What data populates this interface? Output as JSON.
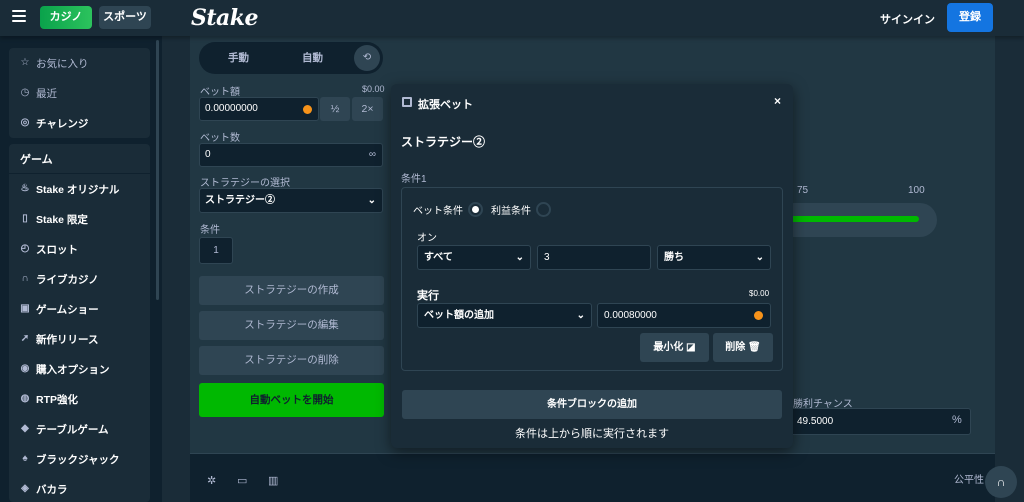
{
  "topbar": {
    "casino": "カジノ",
    "sports": "スポーツ",
    "logo": "Stake",
    "signin": "サインイン",
    "register": "登録"
  },
  "sidebar": {
    "top_items": [
      {
        "label": "お気に入り",
        "icon": "star-icon"
      },
      {
        "label": "最近",
        "icon": "clock-icon"
      },
      {
        "label": "チャレンジ",
        "icon": "target-icon"
      }
    ],
    "games_header": "ゲーム",
    "game_items": [
      {
        "label": "Stake オリジナル",
        "icon": "flame-icon"
      },
      {
        "label": "Stake 限定",
        "icon": "bookmark-icon"
      },
      {
        "label": "スロット",
        "icon": "slot-icon"
      },
      {
        "label": "ライブカジノ",
        "icon": "headset-icon"
      },
      {
        "label": "ゲームショー",
        "icon": "gift-icon"
      },
      {
        "label": "新作リリース",
        "icon": "rocket-icon"
      },
      {
        "label": "購入オプション",
        "icon": "badge-icon"
      },
      {
        "label": "RTP強化",
        "icon": "rtp-icon"
      },
      {
        "label": "テーブルゲーム",
        "icon": "drop-icon"
      },
      {
        "label": "ブラックジャック",
        "icon": "cards-icon"
      },
      {
        "label": "バカラ",
        "icon": "chip-icon"
      }
    ]
  },
  "controls": {
    "mode_manual": "手動",
    "mode_auto": "自動",
    "bet_amount_label": "ベット額",
    "bet_amount_usd": "$0.00",
    "bet_amount_value": "0.00000000",
    "half": "½",
    "double": "2×",
    "bet_count_label": "ベット数",
    "bet_count_value": "0",
    "infinity": "∞",
    "strategy_select_label": "ストラテジーの選択",
    "strategy_selected": "ストラテジー②",
    "conditions_label": "条件",
    "conditions_value": "1",
    "create_strategy": "ストラテジーの作成",
    "edit_strategy": "ストラテジーの編集",
    "delete_strategy": "ストラテジーの削除",
    "start_autobet": "自動ベットを開始"
  },
  "game": {
    "tick_75": "75",
    "tick_100": "100",
    "win_chance_label": "勝利チャンス",
    "win_chance_value": "49.5000",
    "pct": "%",
    "fairness": "公平性"
  },
  "modal": {
    "title": "拡張ベット",
    "close": "×",
    "strategy_name": "ストラテジー②",
    "condition_label": "条件1",
    "radio_bet": "ベット条件",
    "radio_profit": "利益条件",
    "selected_radio": "bet",
    "on_label": "オン",
    "on_select": "すべて",
    "on_count": "3",
    "on_result": "勝ち",
    "exec_label": "実行",
    "exec_usd": "$0.00",
    "exec_action": "ベット額の追加",
    "exec_value": "0.00080000",
    "minimize": "最小化",
    "delete": "削除",
    "add_block": "条件ブロックの追加",
    "note": "条件は上から順に実行されます"
  },
  "colors": {
    "bg": "#1a2c38",
    "panel": "#213743",
    "dark": "#0f212e",
    "accent_green": "#00b801",
    "accent_blue": "#1475e1"
  }
}
